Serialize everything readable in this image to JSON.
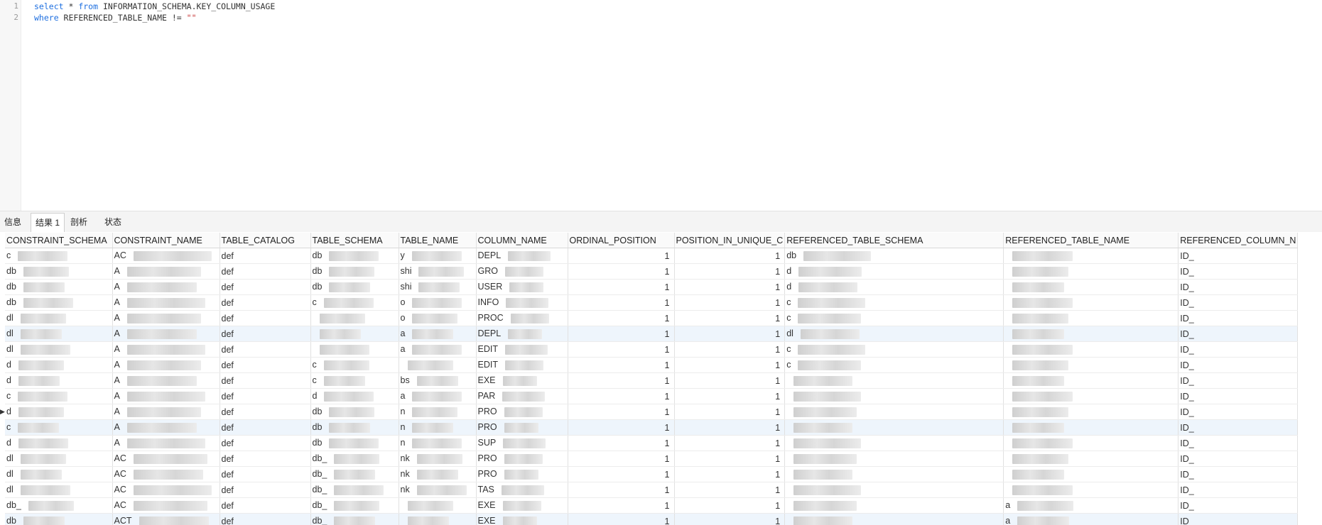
{
  "editor": {
    "lines": [
      {
        "num": "1",
        "parts": [
          {
            "t": "select",
            "c": "kw"
          },
          {
            "t": " * ",
            "c": ""
          },
          {
            "t": "from",
            "c": "kw"
          },
          {
            "t": " INFORMATION_SCHEMA.KEY_COLUMN_USAGE",
            "c": ""
          }
        ]
      },
      {
        "num": "2",
        "parts": [
          {
            "t": "where",
            "c": "kw"
          },
          {
            "t": " REFERENCED_TABLE_NAME != ",
            "c": ""
          },
          {
            "t": "\"\"",
            "c": "str"
          }
        ]
      }
    ]
  },
  "tabs": [
    {
      "label": "信息",
      "active": false
    },
    {
      "label": "结果 1",
      "active": true
    },
    {
      "label": "剖析",
      "active": false
    },
    {
      "label": "状态",
      "active": false
    }
  ],
  "grid": {
    "columns": [
      "CONSTRAINT_SCHEMA",
      "CONSTRAINT_NAME",
      "TABLE_CATALOG",
      "TABLE_SCHEMA",
      "TABLE_NAME",
      "COLUMN_NAME",
      "ORDINAL_POSITION",
      "POSITION_IN_UNIQUE_C",
      "REFERENCED_TABLE_SCHEMA",
      "REFERENCED_TABLE_NAME",
      "REFERENCED_COLUMN_N"
    ],
    "rows": [
      [
        "c",
        "AC",
        "def",
        "db",
        "y",
        "DEPL",
        "1",
        "1",
        "db",
        "",
        "ID_"
      ],
      [
        "db",
        "A",
        "def",
        "db",
        "shi",
        "GRO",
        "1",
        "1",
        "d",
        "",
        "ID_"
      ],
      [
        "db",
        "A",
        "def",
        "db",
        "shi",
        "USER",
        "1",
        "1",
        "d",
        "",
        "ID_"
      ],
      [
        "db",
        "A",
        "def",
        "c",
        "o",
        "INFO",
        "1",
        "1",
        "c",
        "",
        "ID_"
      ],
      [
        "dl",
        "A",
        "def",
        "",
        "o",
        "PROC",
        "1",
        "1",
        "c",
        "",
        "ID_"
      ],
      [
        "dl",
        "A",
        "def",
        "",
        "a",
        "DEPL",
        "1",
        "1",
        "dl",
        "",
        "ID_"
      ],
      [
        "dl",
        "A",
        "def",
        "",
        "a",
        "EDIT",
        "1",
        "1",
        "c",
        "",
        "ID_"
      ],
      [
        "d",
        "A",
        "def",
        "c",
        "",
        "EDIT",
        "1",
        "1",
        "c",
        "",
        "ID_"
      ],
      [
        "d",
        "A",
        "def",
        "c",
        "bs",
        "EXE",
        "1",
        "1",
        "",
        "",
        "ID_"
      ],
      [
        "c",
        "A",
        "def",
        "d",
        "a",
        "PAR",
        "1",
        "1",
        "",
        "",
        "ID_"
      ],
      [
        "d",
        "A",
        "def",
        "db",
        "n",
        "PRO",
        "1",
        "1",
        "",
        "",
        "ID_"
      ],
      [
        "c",
        "A",
        "def",
        "db",
        "n",
        "PRO",
        "1",
        "1",
        "",
        "",
        "ID_"
      ],
      [
        "d",
        "A",
        "def",
        "db",
        "n",
        "SUP",
        "1",
        "1",
        "",
        "",
        "ID_"
      ],
      [
        "dl",
        "AC",
        "def",
        "db_",
        "nk",
        "PRO",
        "1",
        "1",
        "",
        "",
        "ID_"
      ],
      [
        "dl",
        "AC",
        "def",
        "db_",
        "nk",
        "PRO",
        "1",
        "1",
        "",
        "",
        "ID_"
      ],
      [
        "dl",
        "AC",
        "def",
        "db_",
        "nk",
        "TAS",
        "1",
        "1",
        "",
        "",
        "ID_"
      ],
      [
        "db_",
        "AC",
        "def",
        "db_",
        "",
        "EXE",
        "1",
        "1",
        "",
        "a",
        "ID_"
      ],
      [
        "db",
        "ACT",
        "def",
        "db_",
        "",
        "EXE",
        "1",
        "1",
        "",
        "a",
        "ID_"
      ]
    ]
  }
}
